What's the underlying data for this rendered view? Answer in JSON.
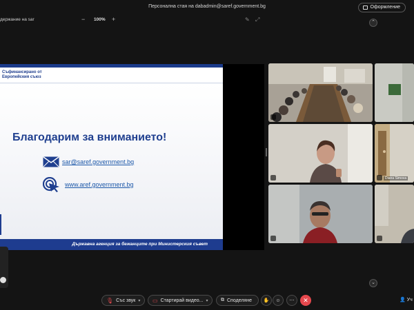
{
  "window": {
    "title": "Персонална стая на dabadmin@saref.government.bg",
    "layout_label": "Оформление"
  },
  "toolbar": {
    "share_label": "держание на sar",
    "zoom_minus": "−",
    "zoom_value": "100%",
    "zoom_plus": "+"
  },
  "slide": {
    "eu_line1": "Съфинансирано от",
    "eu_line2": "Европейския съюз",
    "heading": "Благодарим за вниманието!",
    "email": "sar@saref.government.bg",
    "website": "www.aref.government.bg",
    "footer": "Държавна агенция за бежанците при Министерския съвет"
  },
  "participants": [
    {
      "name": ""
    },
    {
      "name": ""
    },
    {
      "name": ""
    },
    {
      "name": "Diana Simova"
    },
    {
      "name": ""
    },
    {
      "name": ""
    }
  ],
  "controls": {
    "audio_label": "Със звук",
    "video_label": "Стартирай видео...",
    "share_label": "Споделяне",
    "participants_label": "Уч"
  },
  "colors": {
    "brand_blue": "#1e3c8f",
    "end_red": "#e5484d",
    "background": "#141414"
  }
}
